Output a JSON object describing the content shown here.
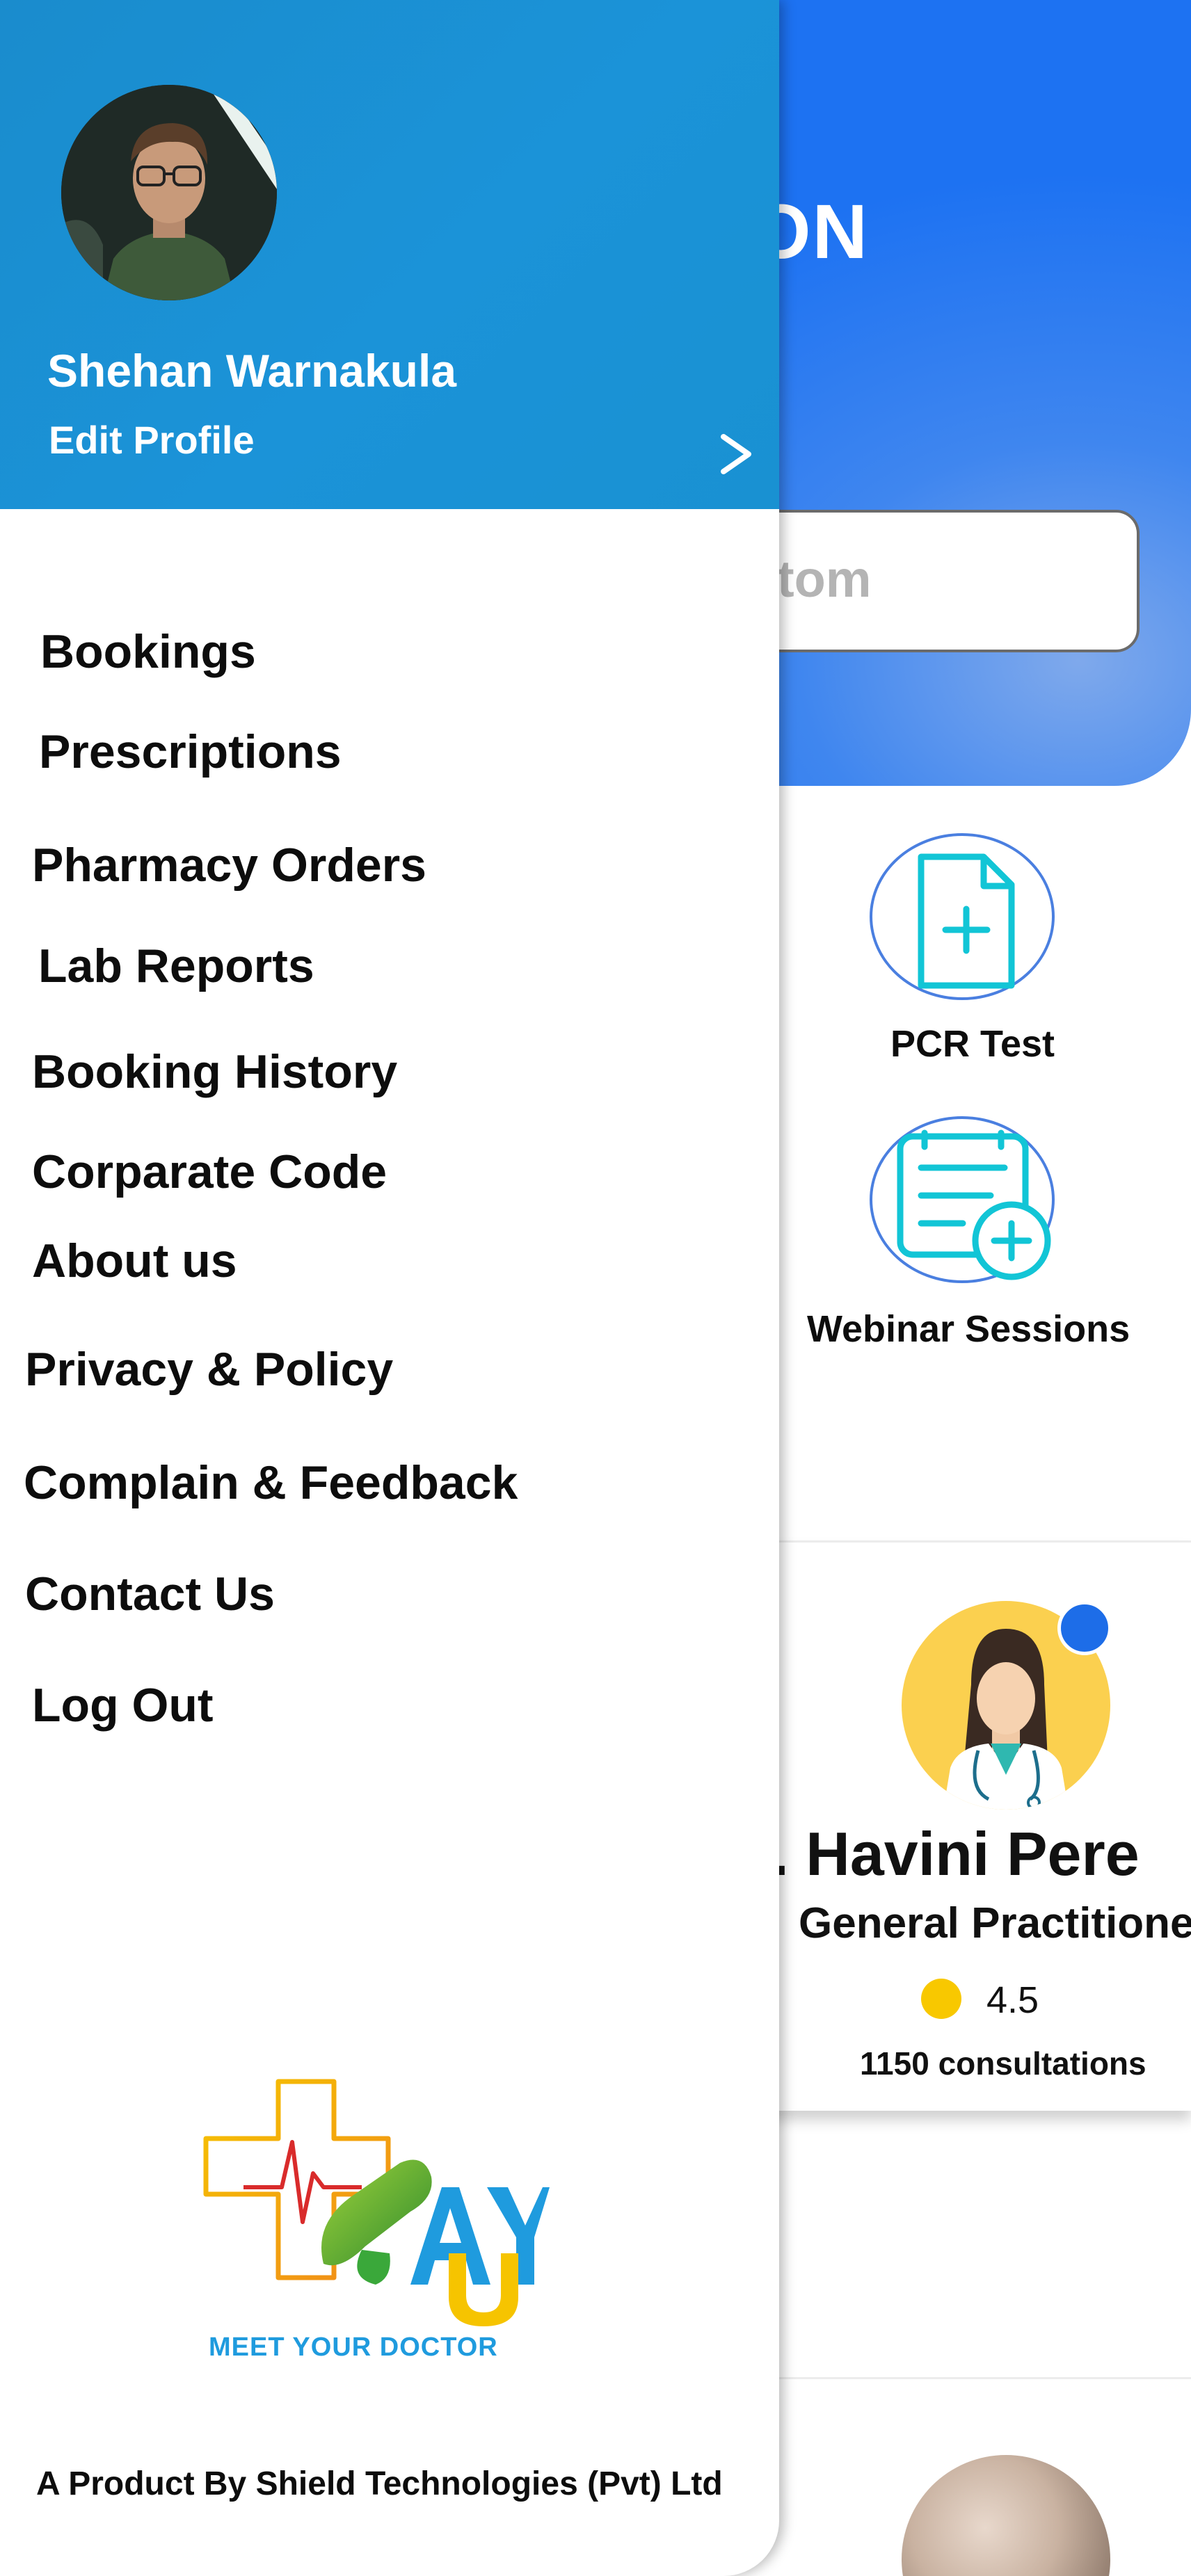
{
  "background": {
    "hero_title_fragment": "ON",
    "search_placeholder": "ymtom",
    "services": [
      {
        "label": "PCR Test",
        "icon": "document-plus-icon"
      },
      {
        "label": "Webinar Sessions",
        "icon": "list-document-plus-icon"
      }
    ],
    "doctor": {
      "name": "r. Havini Pere",
      "specialty": "General Practitione",
      "rating": "4.5",
      "consultations": "1150 consultations"
    }
  },
  "drawer": {
    "profile": {
      "name": "Shehan Warnakula",
      "edit_label": "Edit Profile"
    },
    "menu": [
      "Bookings",
      "Prescriptions",
      "Pharmacy Orders",
      "Lab Reports",
      "Booking History",
      "Corparate Code",
      "About us",
      "Privacy & Policy",
      "Complain & Feedback",
      "Contact Us",
      "Log Out"
    ],
    "logo_tagline": "MEET YOUR DOCTOR",
    "footer": "A Product By Shield Technologies (Pvt) Ltd"
  },
  "colors": {
    "drawer_header": "#1b93d8",
    "hero_blue": "#1d72f2",
    "accent_cyan": "#12c5d6",
    "rating_yellow": "#f8c800",
    "logo_blue": "#1f9bde"
  }
}
